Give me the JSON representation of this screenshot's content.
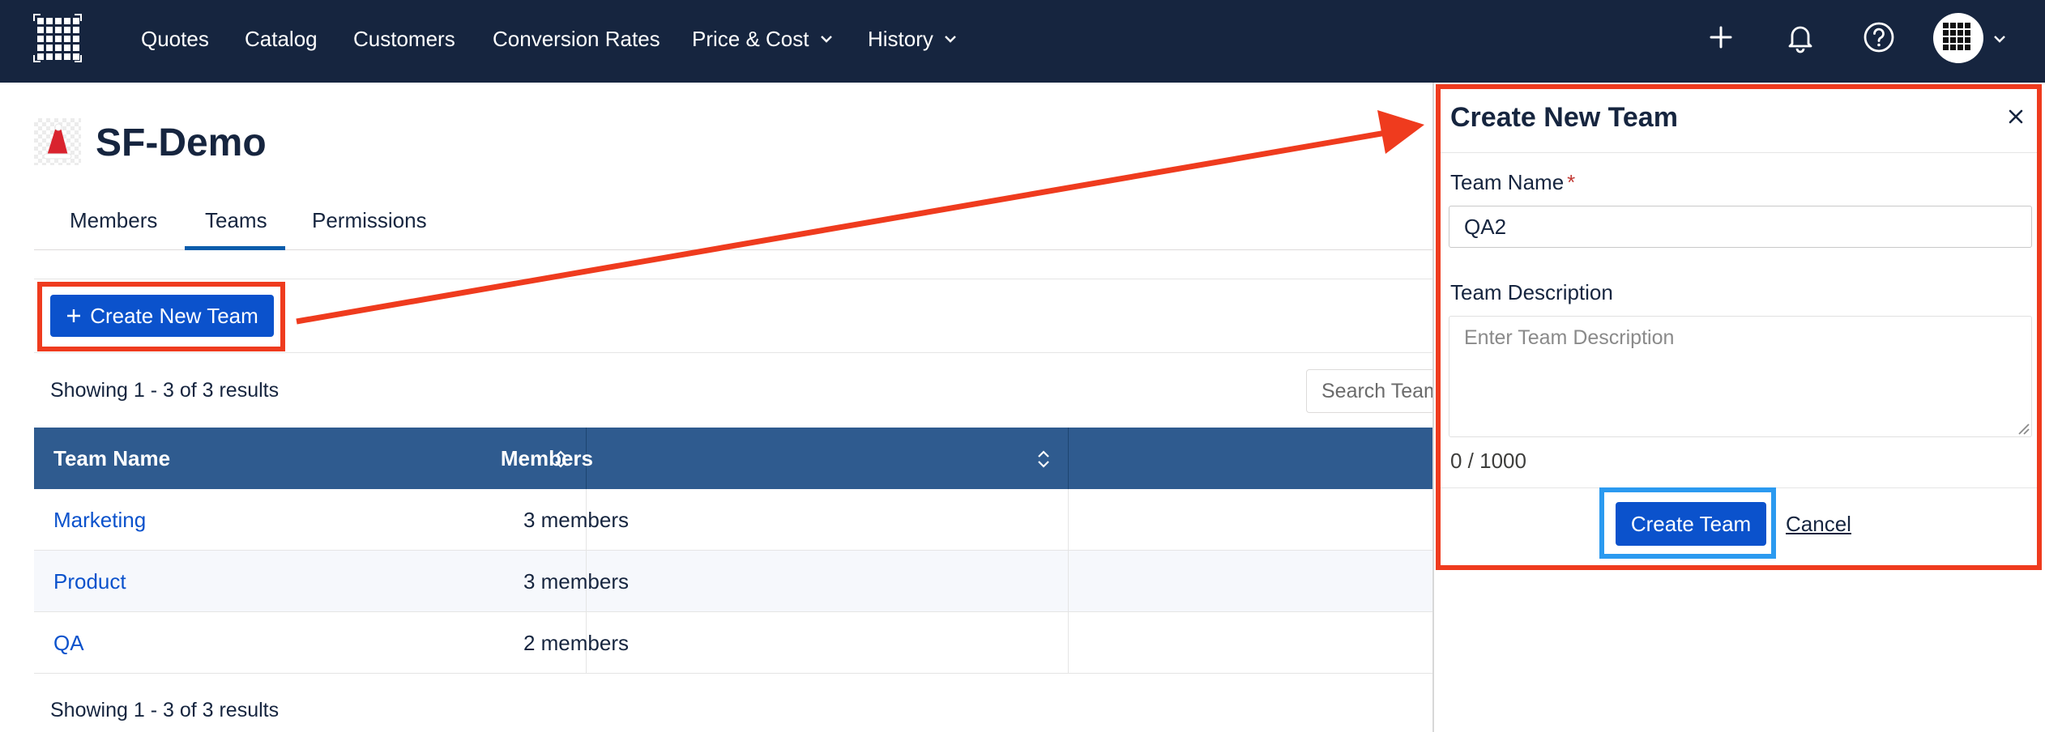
{
  "nav": {
    "items": [
      "Quotes",
      "Catalog",
      "Customers",
      "Conversion Rates",
      "Price & Cost",
      "History"
    ],
    "dropdown_items": [
      "Price & Cost",
      "History"
    ]
  },
  "page": {
    "title": "SF-Demo"
  },
  "tabs": [
    {
      "label": "Members",
      "active": false
    },
    {
      "label": "Teams",
      "active": true
    },
    {
      "label": "Permissions",
      "active": false
    }
  ],
  "toolbar": {
    "create_new_team_label": "Create New Team",
    "results_top": "Showing 1 - 3 of 3 results",
    "results_bottom": "Showing 1 - 3 of 3 results",
    "search_placeholder": "Search Teams"
  },
  "table": {
    "columns": [
      "Team Name",
      "Members"
    ],
    "rows": [
      {
        "team": "Marketing",
        "members": "3 members"
      },
      {
        "team": "Product",
        "members": "3 members"
      },
      {
        "team": "QA",
        "members": "2 members"
      }
    ]
  },
  "panel": {
    "title": "Create New Team",
    "team_name_label": "Team Name",
    "required_mark": "*",
    "team_name_value": "QA2",
    "team_description_label": "Team Description",
    "team_description_placeholder": "Enter Team Description",
    "char_count": "0 / 1000",
    "create_button_label": "Create Team",
    "cancel_label": "Cancel"
  },
  "colors": {
    "topbar": "#16253f",
    "primary": "#0b52cc",
    "table_header": "#2f5b8f",
    "annotation_red": "#ef3b1e",
    "annotation_blue": "#2b9af0"
  },
  "icons": [
    "app-grid-icon",
    "plus-icon",
    "bell-icon",
    "help-icon",
    "avatar-grid-icon",
    "chevron-down-icon",
    "sort-icon",
    "close-icon",
    "resize-grip-icon",
    "santa-hat-logo"
  ]
}
